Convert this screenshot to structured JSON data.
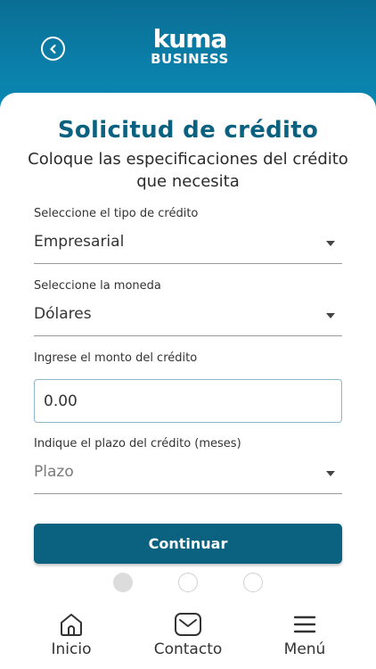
{
  "header": {
    "logo_word": "kuma",
    "logo_sub": "BUSINESS"
  },
  "form": {
    "title": "Solicitud de crédito",
    "subtitle": "Coloque las especificaciones del crédito que necesita",
    "credit_type": {
      "label": "Seleccione el tipo de crédito",
      "value": "Empresarial"
    },
    "currency": {
      "label": "Seleccione la moneda",
      "value": "Dólares"
    },
    "amount": {
      "label": "Ingrese el monto del crédito",
      "value": "0.00"
    },
    "term": {
      "label": "Indique el plazo del crédito (meses)",
      "placeholder": "Plazo"
    },
    "continue_label": "Continuar"
  },
  "stepper": {
    "total_steps": 3,
    "current_step": 1
  },
  "nav": {
    "home": "Inicio",
    "contact": "Contacto",
    "menu": "Menú"
  },
  "colors": {
    "brand": "#0b6280",
    "header": "#0a81ab"
  }
}
